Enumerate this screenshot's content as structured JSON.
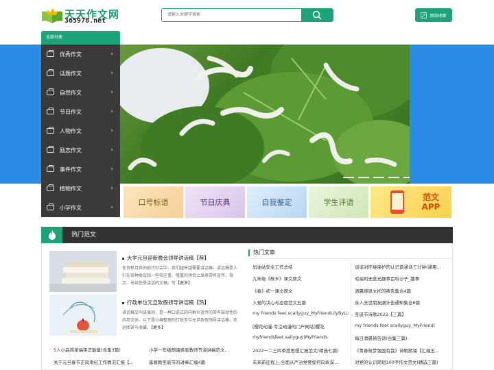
{
  "logo": {
    "title": "天天作文网",
    "sub": "365978.net"
  },
  "search": {
    "placeholder": "请输入关键字搜索"
  },
  "header": {
    "sitemap_label": "网站地图"
  },
  "sidebar": {
    "tab_label": "全部分类",
    "items": [
      {
        "label": "优秀作文"
      },
      {
        "label": "话题作文"
      },
      {
        "label": "自然作文"
      },
      {
        "label": "节日作文"
      },
      {
        "label": "人物作文"
      },
      {
        "label": "励志作文"
      },
      {
        "label": "事件作文"
      },
      {
        "label": "植物作文"
      },
      {
        "label": "小学作文"
      }
    ]
  },
  "cards": [
    {
      "label": "口号标语",
      "color": "#f6d7a8"
    },
    {
      "label": "节日庆典",
      "color": "#e3d4ef"
    },
    {
      "label": "自我鉴定",
      "color": "#c7dff4"
    },
    {
      "label": "学生评语",
      "color": "#d9ecc7"
    },
    {
      "label": "范文 APP",
      "color": "#fbe27a"
    }
  ],
  "hot": {
    "title": "热门范文",
    "articles": [
      {
        "title": "大学元旦迎新晚会领导讲话稿【荐】",
        "desc": "在日新月异的现代社会中，我们越来越需要讲话稿，讲话稿是人们在各种会议和一些较庄重、隆重的场合上发表带有宣传、指示、总结性质讲话的文稿。写",
        "more": "【更多】"
      },
      {
        "title": "行政单位元旦致假领导讲话稿【热】",
        "desc": "讲话稿又叫讲演词，是一种口语式的向群众宣传的带有鼓动性的应用文体。以下是小编整理的行政单位元旦致假领导讲话稿，欢迎阅读与收藏。",
        "more": "【更多】"
      }
    ],
    "bottom_links": [
      "5入小品简单搞笑正能量(合集3篇)",
      "小学一年级朗诵感恩教师节演讲稿范文...",
      "关于元旦春节正风肃纪工作情况汇报【...",
      "基督教圣诞节的讲章汇编4篇"
    ]
  },
  "hot_articles": {
    "title": "热门文章",
    "left": [
      "加油站安全工作总结",
      "九年级《故乡》课文原文",
      "《春》初一课文原文",
      "入党的决心与态度范文五篇",
      "my friends feet scallyguy_MyfriendLilyByLucy",
      "[樱花动漫-专注动漫的门户网站]樱花",
      "myfriendsfeet sallyguy|MyFriends",
      "2022一二三四季度思想汇报范文(精选七篇)",
      "未来新征程上,全面从严治党要如何向纵深..."
    ],
    "right": [
      "谈谈对环境保护的认识普通话三分钟(通用...",
      "宅福利无圣光趣事百科沙子_趣事",
      "清晨感恩文托的祷告集合4篇",
      "亲人去世朋友圈计告通知集合6篇",
      "圣诞节诗歌2022【三篇】",
      "my friends feet scallyguy_MyFriend!",
      "每日清晨祷告词(合集三篇)",
      "《青春筑梦强国有我》诗歌朗诵【汇编五...",
      "对党的认识简短100字作文范文(精选三篇)"
    ]
  }
}
